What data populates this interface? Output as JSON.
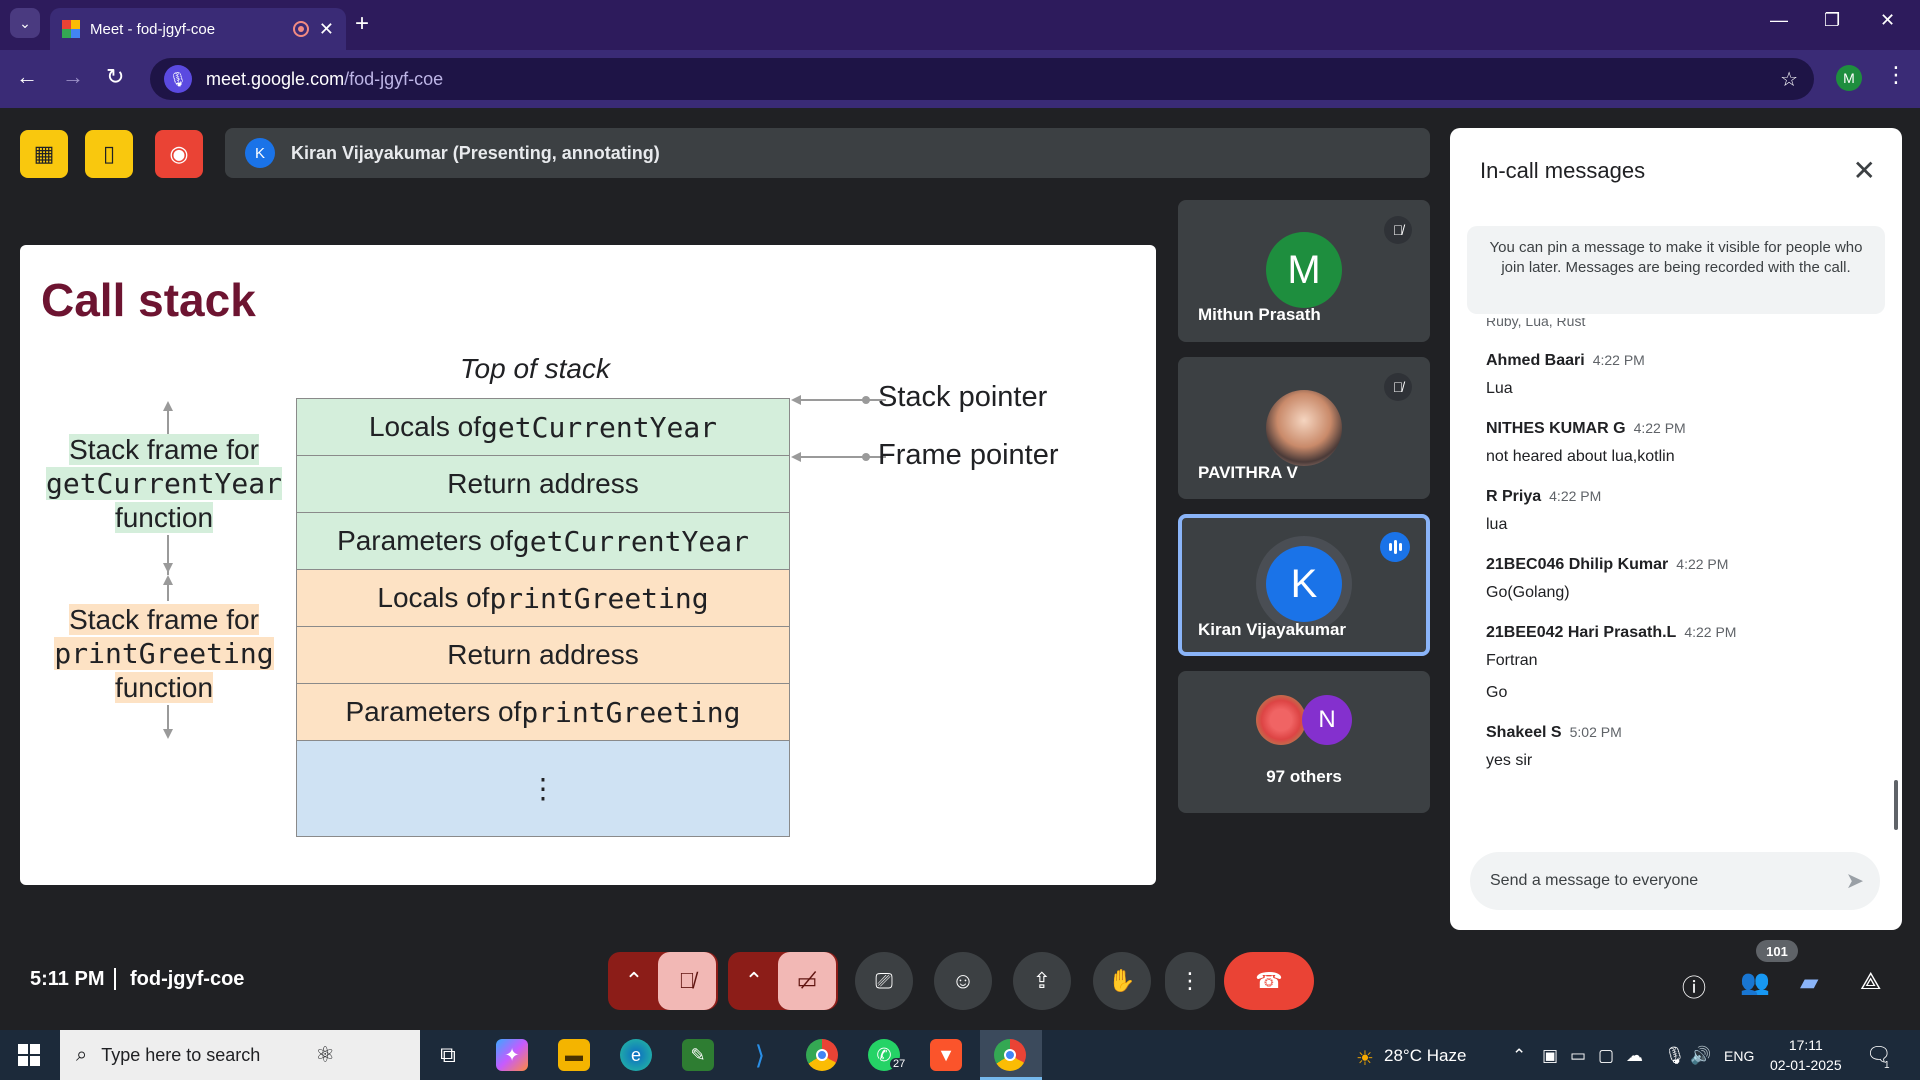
{
  "browser": {
    "tab_title": "Meet - fod-jgyf-coe",
    "url_host": "meet.google.com",
    "url_path": "/fod-jgyf-coe",
    "profile_initial": "M"
  },
  "meet": {
    "presenter_initial": "K",
    "presenter_text": "Kiran Vijayakumar (Presenting, annotating)",
    "time": "5:11 PM",
    "meeting_code": "fod-jgyf-coe",
    "participant_count": "101"
  },
  "slide": {
    "title": "Call stack",
    "top_label": "Top of stack",
    "rows": [
      {
        "prefix": "Locals of ",
        "code": "getCurrentYear",
        "plain": ""
      },
      {
        "prefix": "",
        "code": "",
        "plain": "Return address"
      },
      {
        "prefix": "Parameters of ",
        "code": "getCurrentYear",
        "plain": ""
      },
      {
        "prefix": "Locals of ",
        "code": "printGreeting",
        "plain": ""
      },
      {
        "prefix": "",
        "code": "",
        "plain": "Return address"
      },
      {
        "prefix": "Parameters of ",
        "code": "printGreeting",
        "plain": ""
      }
    ],
    "ellipsis": "⋮",
    "stack_pointer": "Stack pointer",
    "frame_pointer": "Frame pointer",
    "frame1": {
      "line1": "Stack frame for",
      "line2": "getCurrentYear",
      "line3": "function"
    },
    "frame2": {
      "line1": "Stack frame for",
      "line2": "printGreeting",
      "line3": "function"
    }
  },
  "participants": [
    {
      "name": "Mithun Prasath",
      "initial": "M",
      "color": "#1e8e3e"
    },
    {
      "name": "PAVITHRA V"
    },
    {
      "name": "Kiran Vijayakumar",
      "initial": "K",
      "color": "#1a73e8"
    },
    {
      "name": "97 others",
      "initial": "N",
      "color": "#8430ce"
    }
  ],
  "chat": {
    "title": "In-call messages",
    "pin_note": "You can pin a message to make it visible for people who join later. Messages are being recorded with the call.",
    "cutoff_text": "Ruby, Lua, Rust",
    "messages": [
      {
        "sender": "Ahmed Baari",
        "time": "4:22 PM",
        "text": "Lua"
      },
      {
        "sender": "NITHES KUMAR G",
        "time": "4:22 PM",
        "text": "not heared about lua,kotlin"
      },
      {
        "sender": "R Priya",
        "time": "4:22 PM",
        "text": "lua"
      },
      {
        "sender": "21BEC046 Dhilip Kumar",
        "time": "4:22 PM",
        "text": "Go(Golang)"
      },
      {
        "sender": "21BEE042 Hari Prasath.L",
        "time": "4:22 PM",
        "text": "Fortran",
        "text2": "Go"
      },
      {
        "sender": "Shakeel S",
        "time": "5:02 PM",
        "text": "yes sir"
      }
    ],
    "input_placeholder": "Send a message to everyone"
  },
  "taskbar": {
    "search_placeholder": "Type here to search",
    "whatsapp_badge": "27",
    "weather": "28°C  Haze",
    "lang": "ENG",
    "time": "17:11",
    "date": "02-01-2025",
    "notif_count": "1"
  }
}
